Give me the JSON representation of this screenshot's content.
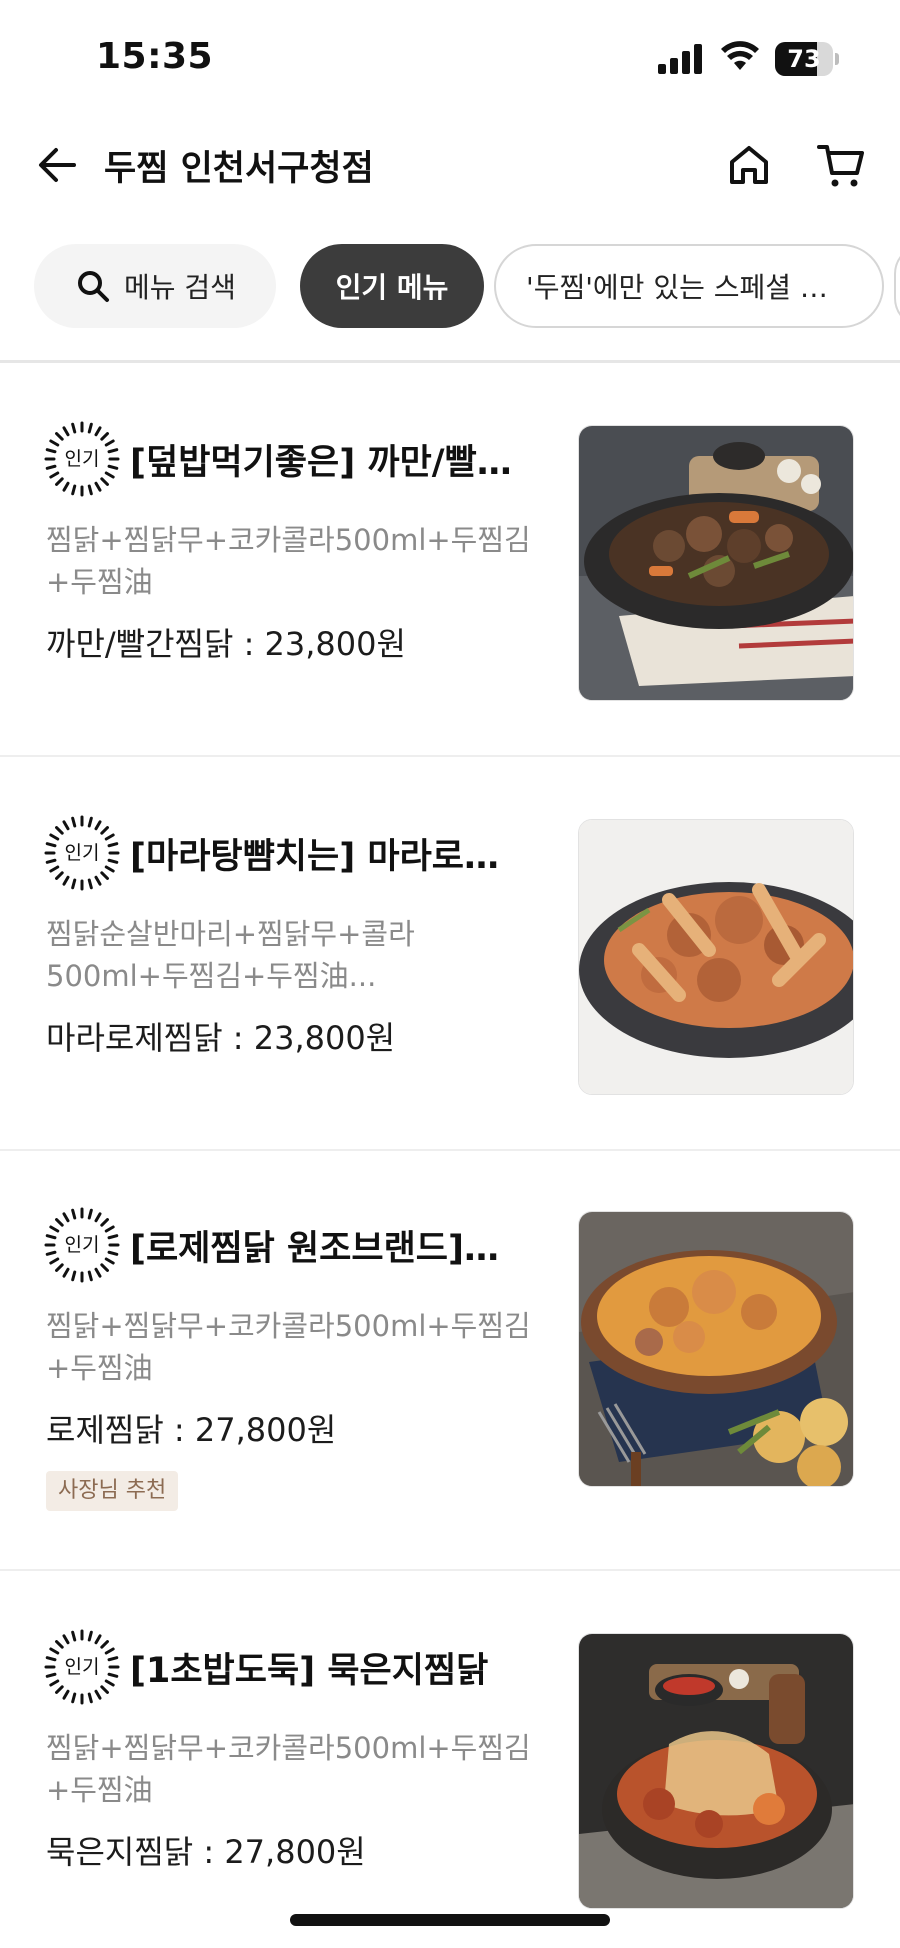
{
  "status_bar": {
    "time": "15:35",
    "battery_level": "73",
    "battery_fraction": 0.73
  },
  "nav": {
    "title": "두찜 인천서구청점",
    "back_icon": "arrow-left-icon",
    "home_icon": "home-icon",
    "cart_icon": "cart-icon"
  },
  "chips": {
    "search_label": "메뉴 검색",
    "popular_label": "인기 메뉴",
    "special_label": "'두찜'에만 있는 스페셜 …"
  },
  "badge_text": "인기",
  "items": [
    {
      "title": "[덮밥먹기좋은] 까만/빨…",
      "desc": "찜닭+찜닭무+코카콜라500ml+두찜김+두찜油",
      "price": "까만/빨간찜닭 : 23,800원",
      "tag": ""
    },
    {
      "title": "[마라탕뺨치는] 마라로…",
      "desc": "찜닭순살반마리+찜닭무+콜라500ml+두찜김+두찜油...",
      "price": "마라로제찜닭 : 23,800원",
      "tag": ""
    },
    {
      "title": "[로제찜닭 원조브랜드]…",
      "desc": "찜닭+찜닭무+코카콜라500ml+두찜김+두찜油",
      "price": "로제찜닭 : 27,800원",
      "tag": "사장님 추천"
    },
    {
      "title": "[1초밥도둑] 묵은지찜닭",
      "desc": "찜닭+찜닭무+코카콜라500ml+두찜김+두찜油",
      "price": "묵은지찜닭 : 27,800원",
      "tag": ""
    }
  ]
}
